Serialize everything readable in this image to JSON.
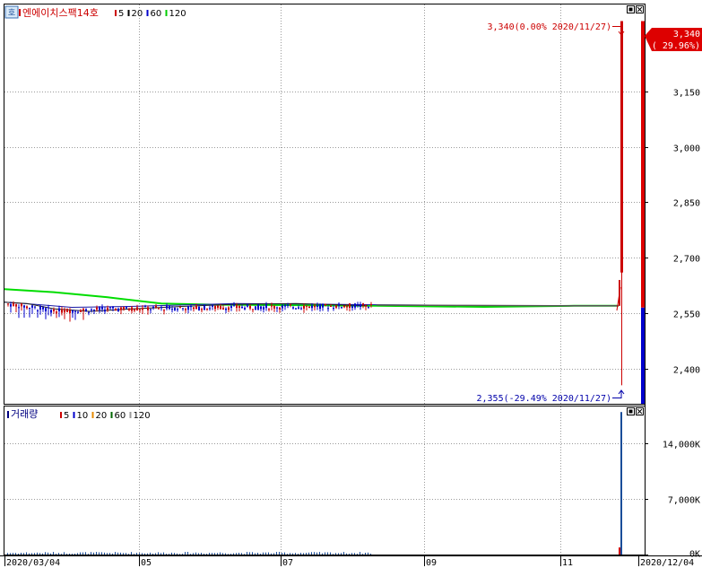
{
  "chart_data": [
    {
      "type": "candlestick",
      "title": "엔에이치스팩14호",
      "moving_average_legend": [
        {
          "label": "5",
          "color": "#cc0000"
        },
        {
          "label": "20",
          "color": "#000000"
        },
        {
          "label": "60",
          "color": "#0000cc"
        },
        {
          "label": "120",
          "color": "#00cc00"
        }
      ],
      "y_ticks": [
        "3,150",
        "3,000",
        "2,850",
        "2,700",
        "2,550",
        "2,400"
      ],
      "y_tick_values": [
        3150,
        3000,
        2850,
        2700,
        2550,
        2400
      ],
      "ylim": [
        2305,
        3385
      ],
      "current_price": {
        "line1": "3,340",
        "line2": "( 29.96%)",
        "value": 3340
      },
      "annotations": {
        "high": {
          "text": "3,340(0.00% 2020/11/27)",
          "value": 3340
        },
        "low": {
          "text": "2,355(-29.49% 2020/11/27)",
          "value": 2355
        }
      },
      "series_summary": {
        "ma120_start": 2615,
        "ma_flat_level": 2570,
        "spike_candle": {
          "date": "2020/11/27",
          "low": 2355,
          "high": 3340
        },
        "last_candle": {
          "date": "2020/12/04",
          "low": 2565,
          "high": 3340
        }
      }
    },
    {
      "type": "bar",
      "title": "거래량",
      "moving_average_legend": [
        {
          "label": "5",
          "color": "#cc0000"
        },
        {
          "label": "10",
          "color": "#0000cc"
        },
        {
          "label": "20",
          "color": "#e68a00"
        },
        {
          "label": "60",
          "color": "#006600"
        },
        {
          "label": "120",
          "color": "#999999"
        }
      ],
      "y_ticks": [
        "14,000K",
        "7,000K",
        "0K"
      ],
      "y_tick_values": [
        14000,
        7000,
        0
      ],
      "ylim": [
        0,
        18700
      ],
      "spike_volume_k": 18000,
      "x_labels": [
        "2020/03/04",
        "05",
        "07",
        "09",
        "11",
        "2020/12/04"
      ]
    }
  ],
  "ui": {
    "side_button": "호",
    "window_controls": [
      "restore",
      "close"
    ]
  }
}
